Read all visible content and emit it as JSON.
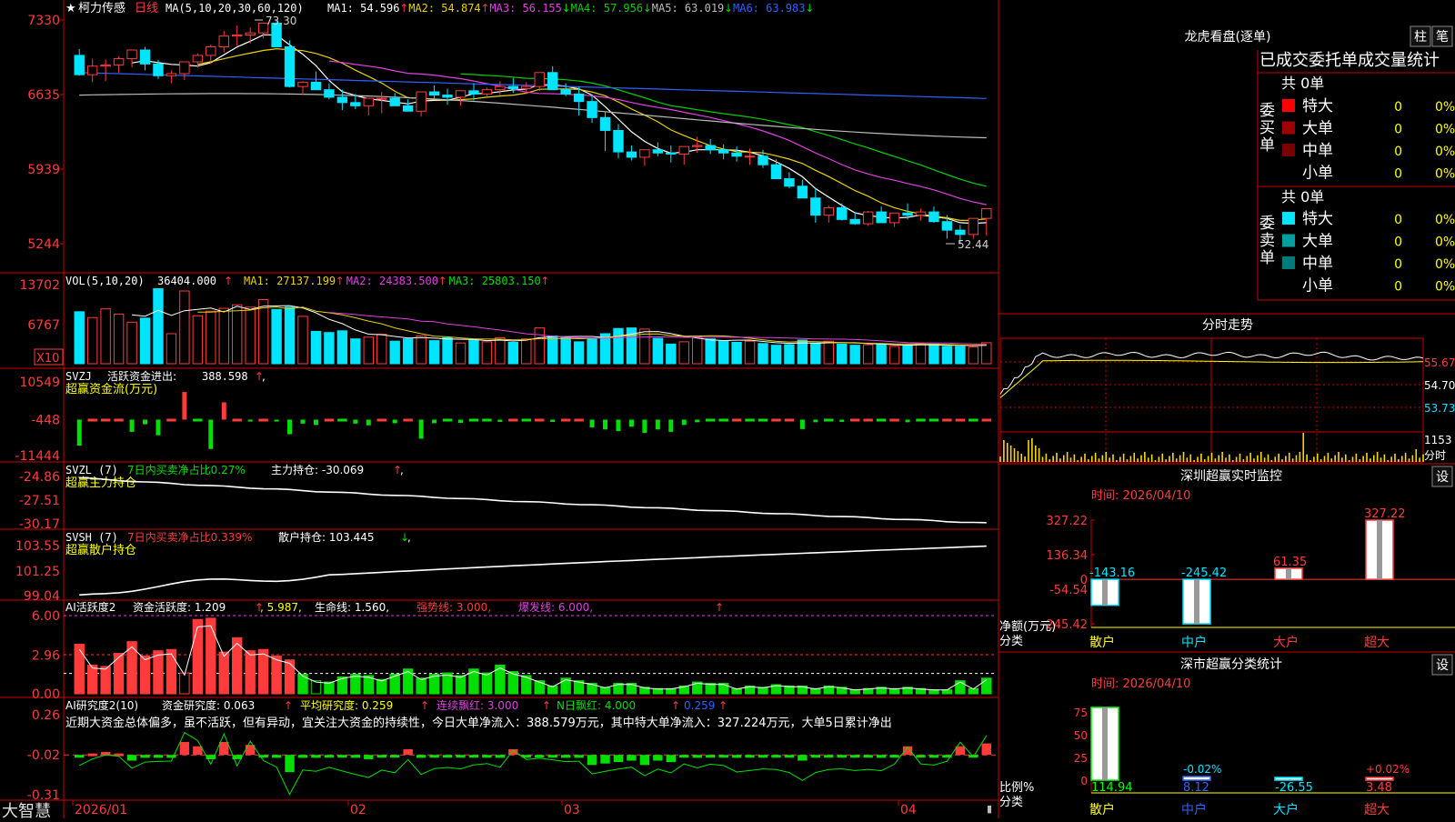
{
  "app": {
    "brand": "大智慧",
    "lock_icon": "lock-icon"
  },
  "colors": {
    "up": "#ff3b3b",
    "down": "#00e5ff",
    "grid": "#cc0000",
    "ma1": "#ffffff",
    "ma2": "#e8d100",
    "ma3": "#e040e0",
    "ma4": "#00d000",
    "ma5": "#bbbbbb",
    "ma6": "#3060ff",
    "green": "#00e000",
    "yellow": "#ffff00",
    "neutral": "#cccccc"
  },
  "main": {
    "star": "★",
    "name": "柯力传感",
    "period": "日线",
    "ma_label": "MA(5,10,20,30,60,120)",
    "ma": [
      {
        "name": "MA1",
        "value": "54.596",
        "arrow": "↑"
      },
      {
        "name": "MA2",
        "value": "54.874",
        "arrow": "↑"
      },
      {
        "name": "MA3",
        "value": "56.155",
        "arrow": "↓"
      },
      {
        "name": "MA4",
        "value": "57.956",
        "arrow": "↓"
      },
      {
        "name": "MA5",
        "value": "63.019",
        "arrow": "↓"
      },
      {
        "name": "MA6",
        "value": "63.983",
        "arrow": "↓"
      }
    ],
    "y_ticks": [
      "7330",
      "6635",
      "5939",
      "5244"
    ],
    "high_label": "73.30",
    "low_label": "52.44"
  },
  "vol": {
    "label": "VOL(5,10,20)",
    "value": "36404.000",
    "v_arrow": "↑",
    "ma": [
      {
        "name": "MA1",
        "value": "27137.199",
        "arrow": "↑"
      },
      {
        "name": "MA2",
        "value": "24383.500",
        "arrow": "↑"
      },
      {
        "name": "MA3",
        "value": "25803.150",
        "arrow": "↑"
      }
    ],
    "y_ticks": [
      "13702",
      "6767"
    ],
    "x10": "X10"
  },
  "svzj": {
    "label": "SVZJ",
    "title": "活跃资金进出:",
    "value": "388.598",
    "arrow": "↑",
    "comma": ",",
    "sub": "超赢资金流(万元)",
    "y_ticks": [
      "10549",
      "-448",
      "-11444"
    ]
  },
  "svzl": {
    "label": "SVZL (7)",
    "title": "7日内买卖净占比0.27%",
    "pos": "主力持仓: -30.069",
    "arrow": "↑",
    "comma": ",",
    "sub": "超赢主力持仓",
    "y_ticks": [
      "-24.86",
      "-27.51",
      "-30.17"
    ]
  },
  "svsh": {
    "label": "SVSH (7)",
    "title": "7日内买卖净占比0.339%",
    "pos": "散户持仓: 103.445",
    "arrow": "↓",
    "comma": ",",
    "sub": "超赢散户持仓",
    "y_ticks": [
      "103.55",
      "101.25",
      "99.04"
    ]
  },
  "ai2": {
    "label": "AI活跃度2",
    "f1": "资金活跃度: 1.209",
    "f1a": "↑",
    "f2": ", 5.987,",
    "f3": "生命线: 1.560,",
    "f4": "强势线: 3.000,",
    "f5": "爆发线: 6.000,",
    "f6": "↑",
    "y_ticks": [
      "6.00",
      "2.96",
      "0.00"
    ]
  },
  "ai_research": {
    "label": "AI研究度2(10)",
    "f1": "资金研究度: 0.063",
    "f1a": "↑",
    "f2": "平均研究度: 0.259",
    "f2a": "↑",
    "f3": "连续飘红: 3.000",
    "f3a": "↑",
    "f4": "N日飘红: 4.000",
    "f4a": "↑",
    "f5": "0.259",
    "f5a": "↑",
    "comment": "近期大资金总体偏多，虽不活跃，但有异动，宜关注大资金的持续性，今日大单净流入：388.579万元，其中特大单净流入：327.224万元，大单5日累计净出",
    "y_ticks": [
      "0.26",
      "-0.02",
      "-0.31"
    ]
  },
  "x_axis": [
    "2026/01",
    "02",
    "03",
    "04"
  ],
  "panel_lhb": {
    "title": "龙虎看盘(逐单)",
    "btn1": "柱",
    "btn2": "笔",
    "head": "已成交委托单成交量统计",
    "buy": {
      "label": "委买单",
      "total": "共 0单",
      "rows": [
        {
          "name": "特大",
          "n": "0",
          "p": "0%",
          "color": "#ff0000"
        },
        {
          "name": "大单",
          "n": "0",
          "p": "0%",
          "color": "#a00000"
        },
        {
          "name": "中单",
          "n": "0",
          "p": "0%",
          "color": "#7a0000"
        },
        {
          "name": "小单",
          "n": "0",
          "p": "0%",
          "color": ""
        }
      ]
    },
    "sell": {
      "label": "委卖单",
      "total": "共 0单",
      "rows": [
        {
          "name": "特大",
          "n": "0",
          "p": "0%",
          "color": "#00e5ff"
        },
        {
          "name": "大单",
          "n": "0",
          "p": "0%",
          "color": "#00a0a0"
        },
        {
          "name": "中单",
          "n": "0",
          "p": "0%",
          "color": "#007a7a"
        },
        {
          "name": "小单",
          "n": "0",
          "p": "0%",
          "color": ""
        }
      ]
    }
  },
  "panel_fs": {
    "title": "分时走势",
    "price_ticks": [
      "55.67",
      "54.70",
      "53.73"
    ],
    "vol_tick": "1153",
    "unit": "分时"
  },
  "panel_sz": {
    "title": "深圳超赢实时监控",
    "btn": "设",
    "time": "时间: 2026/04/10",
    "y_ticks": [
      "327.22",
      "136.34",
      "0",
      "-54.54",
      "-245.42"
    ],
    "ylabel1": "净额(万元)",
    "ylabel2": "分类"
  },
  "panel_cls": {
    "title": "深市超赢分类统计",
    "btn": "设",
    "time": "时间: 2026/04/10",
    "y_ticks": [
      "75",
      "50",
      "25",
      "0"
    ],
    "ylabel1": "比例%",
    "ylabel2": "分类"
  },
  "chart_data": [
    {
      "type": "candlestick",
      "title": "柯力传感 日线",
      "x": [
        "2026-01-05",
        "2026-01-06",
        "2026-01-07",
        "2026-01-08",
        "2026-01-09",
        "2026-01-12",
        "2026-01-13",
        "2026-01-14",
        "2026-01-15",
        "2026-01-16",
        "2026-01-19",
        "2026-01-20",
        "2026-01-21",
        "2026-01-22",
        "2026-01-23",
        "2026-01-26",
        "2026-01-27",
        "2026-01-28",
        "2026-01-29",
        "2026-01-30",
        "2026-02-02",
        "2026-02-03",
        "2026-02-04",
        "2026-02-05",
        "2026-02-06",
        "2026-02-09",
        "2026-02-10",
        "2026-02-11",
        "2026-02-12",
        "2026-02-13",
        "2026-02-16",
        "2026-02-17",
        "2026-02-18",
        "2026-02-19",
        "2026-02-20",
        "2026-02-23",
        "2026-02-24",
        "2026-02-25",
        "2026-02-26",
        "2026-02-27",
        "2026-03-02",
        "2026-03-03",
        "2026-03-04",
        "2026-03-05",
        "2026-03-06",
        "2026-03-09",
        "2026-03-10",
        "2026-03-11",
        "2026-03-12",
        "2026-03-13",
        "2026-03-16",
        "2026-03-17",
        "2026-03-18",
        "2026-03-19",
        "2026-03-20",
        "2026-03-23",
        "2026-03-24",
        "2026-03-25",
        "2026-03-26",
        "2026-03-27",
        "2026-03-30",
        "2026-03-31",
        "2026-04-01",
        "2026-04-02",
        "2026-04-03",
        "2026-04-06",
        "2026-04-07",
        "2026-04-08",
        "2026-04-09",
        "2026-04-10"
      ],
      "open": [
        70.0,
        68.2,
        69.0,
        69.1,
        69.7,
        70.5,
        69.2,
        68.1,
        68.3,
        69.4,
        70.0,
        70.8,
        71.8,
        71.9,
        72.1,
        73.0,
        70.8,
        67.1,
        67.5,
        66.8,
        66.1,
        65.6,
        65.3,
        66.0,
        66.0,
        65.3,
        64.8,
        66.6,
        66.3,
        66.1,
        66.7,
        66.4,
        66.8,
        67.1,
        66.9,
        67.1,
        68.4,
        66.8,
        66.4,
        65.7,
        64.2,
        63.0,
        61.0,
        60.5,
        61.2,
        60.9,
        60.8,
        61.5,
        61.6,
        61.2,
        60.9,
        60.6,
        60.6,
        59.8,
        58.5,
        57.8,
        56.7,
        55.1,
        55.8,
        54.7,
        54.3,
        55.4,
        54.4,
        55.3,
        55.1,
        55.4,
        54.5,
        53.7,
        53.3,
        54.8
      ],
      "high": [
        70.6,
        69.7,
        69.6,
        69.9,
        70.5,
        70.8,
        69.6,
        68.6,
        69.1,
        70.2,
        71.0,
        72.3,
        72.8,
        72.6,
        72.5,
        73.3,
        71.4,
        67.6,
        68.5,
        67.4,
        66.8,
        66.4,
        66.0,
        66.6,
        66.5,
        65.9,
        65.4,
        67.2,
        66.9,
        66.6,
        67.4,
        67.0,
        67.6,
        67.9,
        67.5,
        67.8,
        69.0,
        67.4,
        67.1,
        66.3,
        64.7,
        63.6,
        61.6,
        61.2,
        61.9,
        61.6,
        61.4,
        62.4,
        62.2,
        61.7,
        61.5,
        61.3,
        61.2,
        60.3,
        59.1,
        58.4,
        57.6,
        56.0,
        56.2,
        55.4,
        55.5,
        55.9,
        55.0,
        56.2,
        55.7,
        55.9,
        55.1,
        54.2,
        53.7,
        55.6
      ],
      "low": [
        68.1,
        67.5,
        67.6,
        68.4,
        68.9,
        68.6,
        67.8,
        67.4,
        67.7,
        68.9,
        69.2,
        70.3,
        70.9,
        71.1,
        71.6,
        71.5,
        67.0,
        66.3,
        66.8,
        65.9,
        64.9,
        65.0,
        64.4,
        64.6,
        65.3,
        64.8,
        64.3,
        65.9,
        65.4,
        65.3,
        65.8,
        66.0,
        66.3,
        66.5,
        66.4,
        66.7,
        66.8,
        66.2,
        64.4,
        63.7,
        61.1,
        60.4,
        60.2,
        59.7,
        60.6,
        60.0,
        59.8,
        60.9,
        60.8,
        60.3,
        60.1,
        59.8,
        59.5,
        58.6,
        57.6,
        56.7,
        54.4,
        54.4,
        54.6,
        54.2,
        54.1,
        54.5,
        54.0,
        54.7,
        54.6,
        54.4,
        52.9,
        52.4,
        52.9,
        53.2
      ],
      "close": [
        68.2,
        69.0,
        69.1,
        69.7,
        70.5,
        69.2,
        68.1,
        68.3,
        69.4,
        70.0,
        70.8,
        71.8,
        71.9,
        72.1,
        73.0,
        70.8,
        67.1,
        67.5,
        66.8,
        66.1,
        65.6,
        65.3,
        66.0,
        66.0,
        65.3,
        64.8,
        66.6,
        66.3,
        66.1,
        66.7,
        66.4,
        66.8,
        67.1,
        66.9,
        67.1,
        68.4,
        66.8,
        66.4,
        65.7,
        64.2,
        63.0,
        61.0,
        60.5,
        61.2,
        60.9,
        60.8,
        61.5,
        61.6,
        61.2,
        60.9,
        60.6,
        60.6,
        59.8,
        58.5,
        57.8,
        56.7,
        55.1,
        55.8,
        54.7,
        54.3,
        55.4,
        54.4,
        55.3,
        55.1,
        55.4,
        54.5,
        53.7,
        53.3,
        54.8,
        55.7
      ],
      "y_range": [
        52.44,
        73.3
      ]
    },
    {
      "type": "bar",
      "title": "VOL(5,10,20)",
      "ylim": [
        0,
        13702
      ],
      "values": [
        9000,
        8000,
        9500,
        8600,
        7200,
        7900,
        13000,
        5200,
        12600,
        8300,
        9100,
        9600,
        10200,
        9800,
        11100,
        9400,
        9800,
        8200,
        5600,
        5400,
        5700,
        4300,
        4600,
        5100,
        3900,
        4300,
        4800,
        4000,
        4500,
        3600,
        4100,
        3800,
        4500,
        3700,
        4300,
        6200,
        4800,
        4500,
        3800,
        4300,
        5200,
        6100,
        6200,
        6000,
        4400,
        3400,
        3800,
        4700,
        4300,
        3900,
        3700,
        3900,
        3500,
        3200,
        3300,
        4100,
        3600,
        3900,
        3400,
        3200,
        3300,
        3400,
        3000,
        3200,
        3400,
        3400,
        3000,
        3000,
        2900,
        3640
      ]
    },
    {
      "type": "bar",
      "title": "超赢资金流(万元)",
      "ylim": [
        -11444,
        10549
      ],
      "values": [
        -8000,
        -700,
        -700,
        -700,
        -4000,
        -1800,
        -5000,
        200,
        7600,
        -800,
        -9000,
        4600,
        -600,
        -1000,
        -700,
        -1000,
        -4700,
        -1600,
        -2000,
        -700,
        -900,
        -1600,
        -2100,
        -700,
        -1500,
        -600,
        -6000,
        -1500,
        -900,
        -1400,
        -800,
        -900,
        -1100,
        -600,
        -900,
        -700,
        -1100,
        -700,
        -700,
        -2700,
        -3300,
        -3800,
        -2500,
        -4300,
        -3300,
        -4000,
        -2000,
        -1200,
        -800,
        -900,
        -700,
        -800,
        -900,
        -700,
        -600,
        -3200,
        -1200,
        -800,
        -1100,
        -700,
        -700,
        -900,
        -700,
        -1200,
        -900,
        -900,
        -700,
        -600,
        -800,
        389
      ]
    },
    {
      "type": "line",
      "title": "超赢主力持仓",
      "ylim": [
        -30.17,
        -24.86
      ],
      "note": "SVZL 7-day"
    },
    {
      "type": "line",
      "title": "超赢散户持仓",
      "ylim": [
        99.04,
        103.55
      ],
      "note": "SVSH 7-day"
    },
    {
      "type": "bar",
      "title": "AI活跃度2",
      "ylim": [
        0,
        6.0
      ],
      "lines": {
        "生命线": 1.56,
        "强势线": 3.0,
        "爆发线": 6.0
      },
      "values": [
        3.8,
        2.2,
        2.1,
        3.1,
        4.0,
        2.9,
        3.3,
        3.4,
        1.6,
        5.7,
        5.8,
        3.2,
        4.3,
        3.3,
        3.4,
        2.9,
        2.6,
        1.5,
        1.0,
        0.9,
        1.3,
        1.5,
        1.4,
        1.1,
        1.5,
        1.9,
        1.2,
        1.5,
        1.6,
        1.4,
        1.9,
        1.6,
        2.2,
        1.7,
        1.4,
        1.0,
        0.6,
        1.2,
        1.0,
        0.8,
        0.5,
        0.8,
        0.8,
        0.5,
        0.4,
        0.4,
        0.6,
        0.9,
        0.8,
        0.8,
        0.4,
        0.6,
        0.5,
        0.7,
        0.6,
        0.6,
        0.4,
        0.6,
        0.5,
        0.3,
        0.4,
        0.5,
        0.4,
        0.5,
        0.4,
        0.3,
        0.3,
        1.0,
        0.4,
        1.2
      ]
    },
    {
      "type": "bar",
      "title": "AI研究度2(10)",
      "ylim": [
        -0.31,
        0.26
      ],
      "values": [
        -0.03,
        -0.01,
        0.0,
        -0.01,
        -0.06,
        -0.04,
        -0.04,
        -0.04,
        0.07,
        0.04,
        -0.05,
        0.07,
        -0.05,
        0.05,
        -0.02,
        -0.04,
        -0.14,
        -0.04,
        -0.04,
        -0.02,
        -0.03,
        -0.04,
        -0.05,
        -0.02,
        -0.03,
        0.02,
        -0.04,
        -0.02,
        -0.02,
        -0.03,
        -0.02,
        -0.02,
        -0.04,
        0.02,
        -0.02,
        -0.02,
        -0.03,
        -0.04,
        -0.04,
        -0.09,
        -0.08,
        -0.07,
        -0.06,
        -0.09,
        -0.06,
        -0.07,
        -0.03,
        -0.04,
        -0.02,
        -0.02,
        -0.04,
        -0.03,
        -0.02,
        -0.02,
        -0.03,
        -0.06,
        -0.03,
        -0.02,
        -0.02,
        -0.03,
        -0.03,
        -0.04,
        -0.02,
        0.04,
        -0.03,
        -0.04,
        -0.03,
        0.04,
        -0.02,
        0.06
      ]
    },
    {
      "type": "line",
      "title": "分时走势",
      "ylim": [
        53.73,
        55.67
      ]
    },
    {
      "type": "bar",
      "title": "深圳超赢实时监控",
      "categories": [
        "散户",
        "中户",
        "大户",
        "超大"
      ],
      "values": [
        -143.16,
        -245.42,
        61.35,
        327.22
      ],
      "ylim": [
        -245.42,
        327.22
      ]
    },
    {
      "type": "bar",
      "title": "深市超赢分类统计",
      "categories": [
        "散户",
        "中户",
        "大户",
        "超大"
      ],
      "values": [
        114.94,
        8.12,
        -26.55,
        3.48
      ],
      "annotations": [
        "-0.02%",
        "+0.02%"
      ],
      "ylim": [
        0,
        75
      ]
    }
  ]
}
